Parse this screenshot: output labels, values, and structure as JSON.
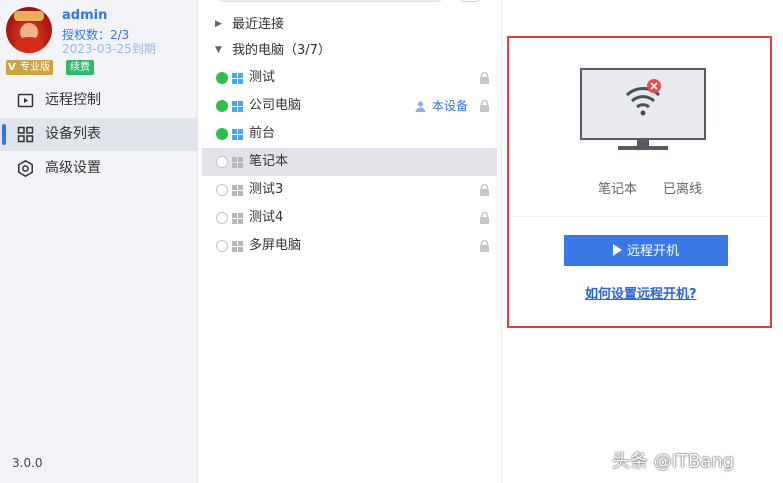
{
  "profile": {
    "username": "admin",
    "license": "授权数：2/3",
    "expire": "2023-03-25到期",
    "badge_edition": "专业版",
    "badge_renew": "续费"
  },
  "menu": {
    "items": [
      {
        "label": "远程控制",
        "icon": "remote-control-icon",
        "active": false
      },
      {
        "label": "设备列表",
        "icon": "grid-icon",
        "active": true
      },
      {
        "label": "高级设置",
        "icon": "gear-icon",
        "active": false
      }
    ]
  },
  "version": "3.0.0",
  "device_list": {
    "recent_label": "最近连接",
    "my_devices_label": "我的电脑（3/7）",
    "self_label": "本设备",
    "devices": [
      {
        "name": "测试",
        "online": true
      },
      {
        "name": "公司电脑",
        "online": true
      },
      {
        "name": "前台",
        "online": true
      },
      {
        "name": "笔记本",
        "online": false
      },
      {
        "name": "测试3",
        "online": false
      },
      {
        "name": "测试4",
        "online": false
      },
      {
        "name": "多屏电脑",
        "online": false
      }
    ]
  },
  "detail": {
    "device_name": "笔记本",
    "status": "已离线",
    "wake_button": "远程开机",
    "help_link": "如何设置远程开机?"
  },
  "colors": {
    "accent": "#3575e8",
    "online": "#2fbf4f",
    "highlight_border": "#e23b3b"
  },
  "watermark": "头条 @ITBang"
}
